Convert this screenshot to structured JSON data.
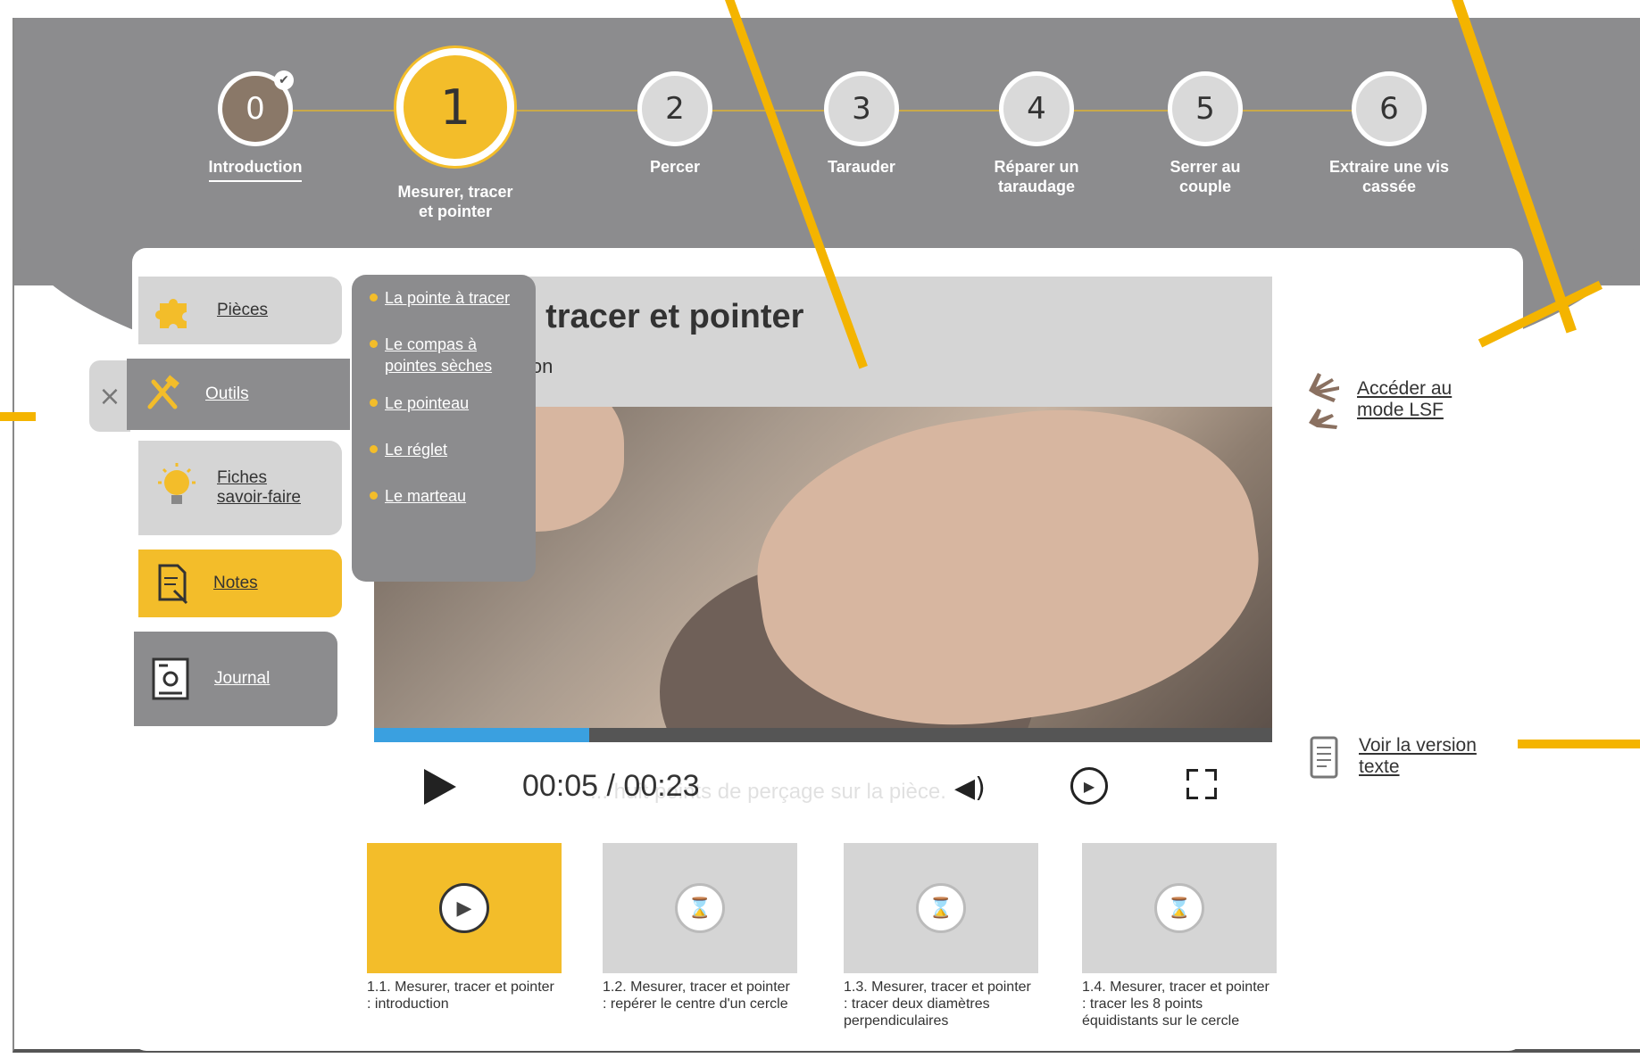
{
  "steps": [
    {
      "number": "0",
      "label": "Introduction"
    },
    {
      "number": "1",
      "label": "Mesurer, tracer et pointer"
    },
    {
      "number": "2",
      "label": "Percer"
    },
    {
      "number": "3",
      "label": "Tarauder"
    },
    {
      "number": "4",
      "label": "Réparer un taraudage"
    },
    {
      "number": "5",
      "label": "Serrer au couple"
    },
    {
      "number": "6",
      "label": "Extraire une vis cassée"
    }
  ],
  "menu": [
    {
      "label": "Pièces"
    },
    {
      "label": "Outils"
    },
    {
      "label": "Fiches savoir-faire"
    },
    {
      "label": "Notes"
    },
    {
      "label": "Journal"
    }
  ],
  "close_label": "×",
  "submenu": [
    {
      "label": "La pointe à tracer"
    },
    {
      "label": "Le compas à pointes sèches"
    },
    {
      "label": "Le pointeau"
    },
    {
      "label": "Le réglet"
    },
    {
      "label": "Le marteau"
    }
  ],
  "video": {
    "title_visible": ", tracer et pointer",
    "subtitle_visible": "ion",
    "time": "00:05 / 00:23",
    "caption": "... huit points de perçage sur la pièce.",
    "progress": 0.24
  },
  "thumbnails": [
    {
      "label": "1.1. Mesurer, tracer et pointer : introduction",
      "icon": "play-icon"
    },
    {
      "label": "1.2. Mesurer, tracer et pointer : repérer le centre d'un cercle",
      "icon": "hourglass-icon"
    },
    {
      "label": "1.3. Mesurer, tracer et pointer : tracer deux diamètres perpendiculaires",
      "icon": "hourglass-icon"
    },
    {
      "label": "1.4. Mesurer, tracer et pointer : tracer les 8 points équidistants sur le cercle",
      "icon": "hourglass-icon"
    }
  ],
  "side_links": {
    "lsf": "Accéder au mode LSF",
    "text_version": "Voir la version texte"
  },
  "colors": {
    "accent": "#f3bd2a",
    "band": "#8c8c8e",
    "annotation": "#f4b400",
    "progress": "#3aa0e0"
  }
}
